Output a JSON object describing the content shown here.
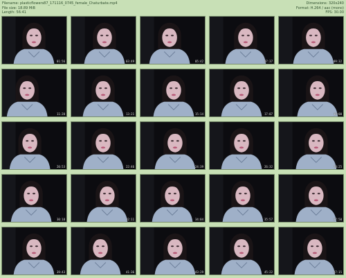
{
  "header": {
    "filename_label": "Filename: plasticflowers87_171116_0745_female_Chaturbate.mp4",
    "filesize_label": "File size: 18.89 MiB",
    "length_label": "Length: 56:41",
    "dimensions_label": "Dimensions: 320x240",
    "format_label": "Format: H.264 / aac (mono)",
    "fps_label": "FPS: 30.00"
  },
  "thumbnails": [
    {
      "timestamp": "01:56"
    },
    {
      "timestamp": "03:49"
    },
    {
      "timestamp": "05:42"
    },
    {
      "timestamp": "07:37"
    },
    {
      "timestamp": "09:32"
    },
    {
      "timestamp": "11:20"
    },
    {
      "timestamp": "13:21"
    },
    {
      "timestamp": "15:14"
    },
    {
      "timestamp": "17:07"
    },
    {
      "timestamp": "19:00"
    },
    {
      "timestamp": "20:53"
    },
    {
      "timestamp": "22:46"
    },
    {
      "timestamp": "24:39"
    },
    {
      "timestamp": "26:32"
    },
    {
      "timestamp": "28:25"
    },
    {
      "timestamp": "30:18"
    },
    {
      "timestamp": "32:11"
    },
    {
      "timestamp": "34:04"
    },
    {
      "timestamp": "35:57"
    },
    {
      "timestamp": "37:50"
    },
    {
      "timestamp": "39:43"
    },
    {
      "timestamp": "41:36"
    },
    {
      "timestamp": "43:29"
    },
    {
      "timestamp": "45:22"
    },
    {
      "timestamp": "47:15"
    }
  ]
}
